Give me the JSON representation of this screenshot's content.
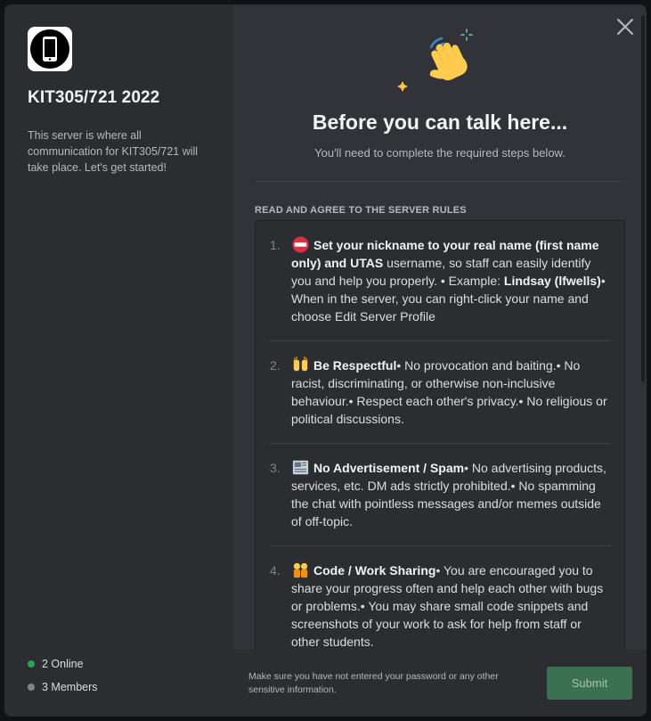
{
  "server": {
    "name": "KIT305/721 2022",
    "description": "This server is where all communication for KIT305/721 will take place. Let's get started!",
    "online": "2 Online",
    "members": "3 Members"
  },
  "modal": {
    "title": "Before you can talk here...",
    "subtitle": "You'll need to complete the required steps below.",
    "rules_heading": "READ AND AGREE TO THE SERVER RULES",
    "footer_note": "Make sure you have not entered your password or any other sensitive information.",
    "submit_label": "Submit"
  },
  "rules": [
    {
      "num": "1.",
      "emoji": "no-entry-icon",
      "bold": "Set your nickname to your real name (first name only) and UTAS",
      "text": " username, so staff can easily identify you and help you properly. • Example: ",
      "bold2": "Lindsay (lfwells)",
      "text2": "• When in the server, you can right-click your name and choose Edit Server Profile"
    },
    {
      "num": "2.",
      "emoji": "raised-hands-icon",
      "bold": "Be Respectful",
      "text": "• No provocation and baiting.• No racist, discriminating, or otherwise non-inclusive behaviour.• Respect each other's privacy.• No religious or political discussions."
    },
    {
      "num": "3.",
      "emoji": "newspaper-icon",
      "bold": "No Advertisement / Spam",
      "text": "• No advertising products, services, etc. DM ads strictly prohibited.• No spamming the chat with pointless messages and/or memes outside of off-topic."
    },
    {
      "num": "4.",
      "emoji": "people-holding-hands-icon",
      "bold": "Code / Work Sharing",
      "text": "• You are encouraged you to share your progress often and help each other with bugs or problems.• You may share small code snippets and screenshots of your work to ask for help from staff or other students."
    }
  ],
  "colors": {
    "online": "#23a55a",
    "submit": "#3b7150",
    "panel": "#2b2d31",
    "background": "#313338"
  }
}
